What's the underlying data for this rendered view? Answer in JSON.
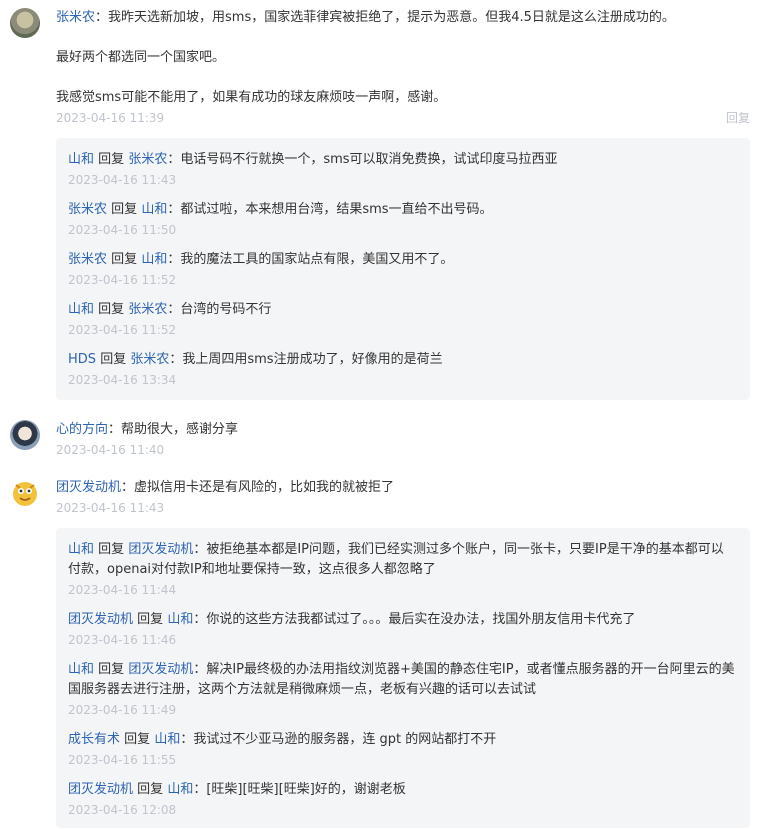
{
  "comments": [
    {
      "user": "张米农",
      "lines": [
        "我昨天选新加坡，用sms，国家选菲律宾被拒绝了，提示为恶意。但我4.5日就是这么注册成功的。",
        "最好两个都选同一个国家吧。",
        "我感觉sms可能不能用了，如果有成功的球友麻烦吱一声啊，感谢。"
      ],
      "time": "2023-04-16 11:39",
      "reply_label": "回复",
      "replies": [
        {
          "from": "山和",
          "sep": "回复",
          "to": "张米农",
          "text": "电话号码不行就换一个，sms可以取消免费换，试试印度马拉西亚",
          "time": "2023-04-16 11:43"
        },
        {
          "from": "张米农",
          "sep": "回复",
          "to": "山和",
          "text": "都试过啦，本来想用台湾，结果sms一直给不出号码。",
          "time": "2023-04-16 11:50"
        },
        {
          "from": "张米农",
          "sep": "回复",
          "to": "山和",
          "text": "我的魔法工具的国家站点有限，美国又用不了。",
          "time": "2023-04-16 11:52"
        },
        {
          "from": "山和",
          "sep": "回复",
          "to": "张米农",
          "text": "台湾的号码不行",
          "time": "2023-04-16 11:52"
        },
        {
          "from": "HDS",
          "sep": "回复",
          "to": "张米农",
          "text": "我上周四用sms注册成功了，好像用的是荷兰",
          "time": "2023-04-16 13:34"
        }
      ]
    },
    {
      "user": "心的方向",
      "text": "帮助很大，感谢分享",
      "time": "2023-04-16 11:40"
    },
    {
      "user": "团灭发动机",
      "text": "虚拟信用卡还是有风险的，比如我的就被拒了",
      "time": "2023-04-16 11:43",
      "replies": [
        {
          "from": "山和",
          "sep": "回复",
          "to": "团灭发动机",
          "text": "被拒绝基本都是IP问题，我们已经实测过多个账户，同一张卡，只要IP是干净的基本都可以付款，openai对付款IP和地址要保持一致，这点很多人都忽略了",
          "time": "2023-04-16 11:44"
        },
        {
          "from": "团灭发动机",
          "sep": "回复",
          "to": "山和",
          "text": "你说的这些方法我都试过了。。。最后实在没办法，找国外朋友信用卡代充了",
          "time": "2023-04-16 11:46"
        },
        {
          "from": "山和",
          "sep": "回复",
          "to": "团灭发动机",
          "text": "解决IP最终极的办法用指纹浏览器+美国的静态住宅IP，或者懂点服务器的开一台阿里云的美国服务器去进行注册，这两个方法就是稍微麻烦一点，老板有兴趣的话可以去试试",
          "time": "2023-04-16 11:49"
        },
        {
          "from": "成长有术",
          "sep": "回复",
          "to": "山和",
          "text": "我试过不少亚马逊的服务器，连 gpt 的网站都打不开",
          "time": "2023-04-16 11:55"
        },
        {
          "from": "团灭发动机",
          "sep": "回复",
          "to": "山和",
          "text": "[旺柴][旺柴][旺柴]好的，谢谢老板",
          "time": "2023-04-16 12:08"
        }
      ]
    }
  ],
  "colon": "："
}
